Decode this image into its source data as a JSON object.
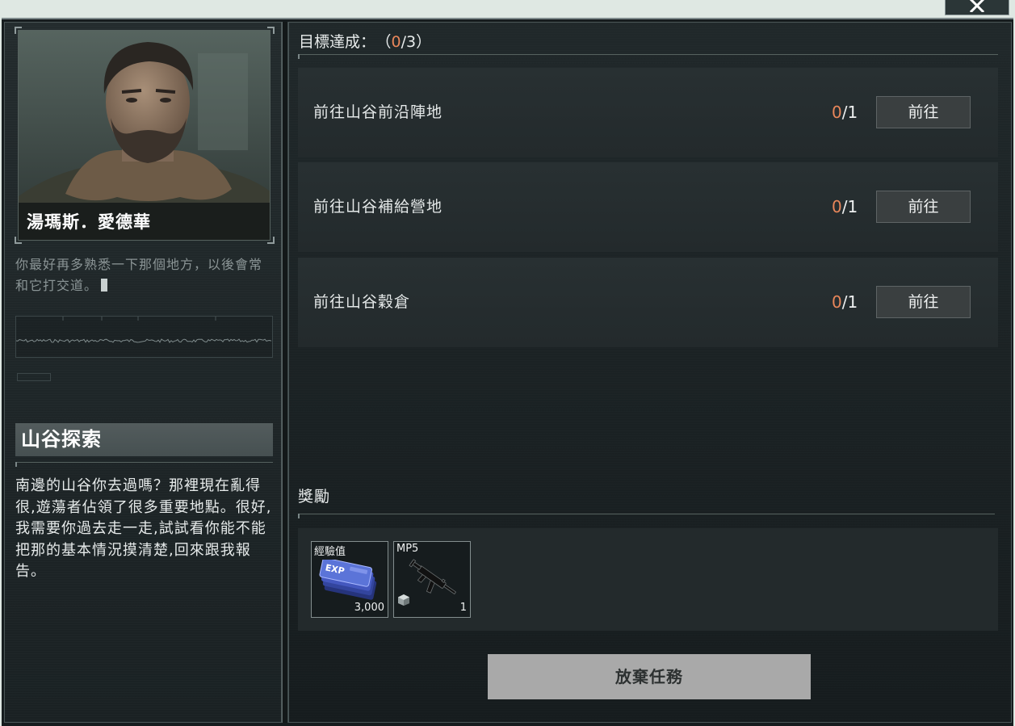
{
  "window": {
    "close_icon": "close-icon"
  },
  "colors": {
    "accent_orange": "#e8865a",
    "panel_bg": "#1d2426",
    "quest_title_band": "#4a5354",
    "go_button_bg": "#3a3f40",
    "abandon_button_bg": "#a9a9a9"
  },
  "npc": {
    "portrait_icon": "npc-portrait",
    "name": "湯瑪斯．愛德華",
    "dialogue_lines": [
      "你最好再多熟悉一下那個地方，以後會常",
      "和它打交道。"
    ]
  },
  "quest": {
    "title": "山谷探索",
    "description_lines": [
      "南邊的山谷你去過嗎？那裡現在亂得",
      "很,遊蕩者佔領了很多重要地點。很好,",
      "我需要你過去走一走,試試看你能不能",
      "把那的基本情況摸清楚,回來跟我報",
      "告。"
    ]
  },
  "objectives": {
    "label": "目標達成：",
    "progress_open": "（",
    "progress_done": "0",
    "progress_rest": "/3",
    "progress_close": "）",
    "items": [
      {
        "label": "前往山谷前沿陣地",
        "current": "0",
        "required": "/1",
        "button_label": "前往"
      },
      {
        "label": "前往山谷補給營地",
        "current": "0",
        "required": "/1",
        "button_label": "前往"
      },
      {
        "label": "前往山谷穀倉",
        "current": "0",
        "required": "/1",
        "button_label": "前往"
      }
    ]
  },
  "rewards": {
    "label": "獎勵",
    "items": [
      {
        "label": "經驗值",
        "icon": "exp-ticket-icon",
        "icon_text": "EXP",
        "amount": "3,000"
      },
      {
        "label": "MP5",
        "icon": "mp5-smg-icon",
        "badge_icon": "box-icon",
        "amount": "1"
      }
    ]
  },
  "abandon_button_label": "放棄任務"
}
